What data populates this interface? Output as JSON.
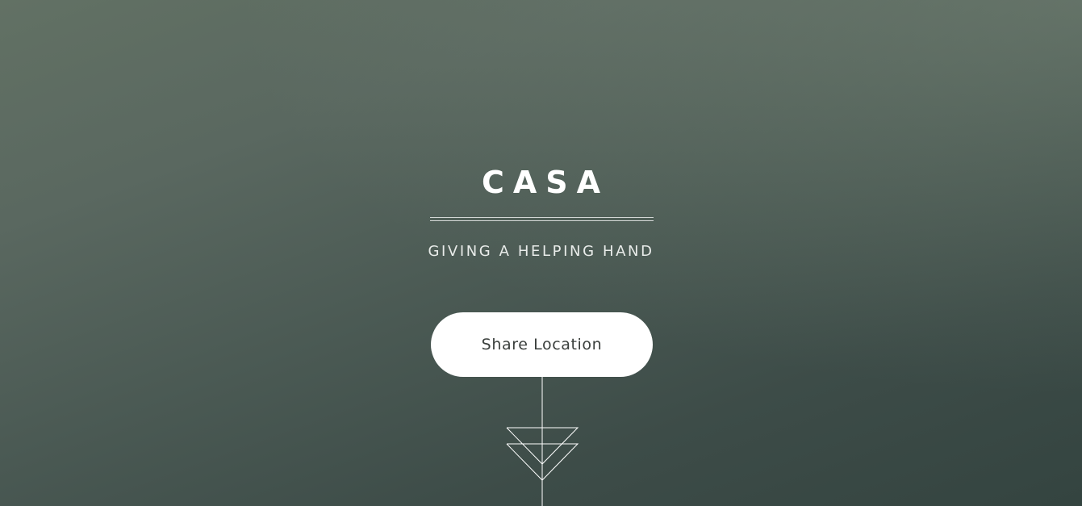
{
  "hero": {
    "title": "CASA",
    "tagline": "GIVING A HELPING HAND",
    "cta_label": "Share Location"
  },
  "icons": {
    "scroll_indicator": "down-arrow-icon"
  },
  "colors": {
    "background_top": "#627164",
    "background_bottom": "#344440",
    "text": "#ffffff",
    "button_bg": "#ffffff",
    "button_text": "#3a3f3c"
  }
}
